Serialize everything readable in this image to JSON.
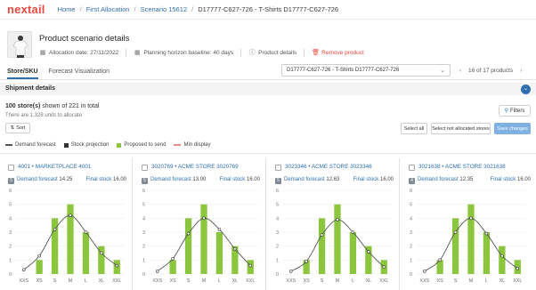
{
  "header": {
    "logo": "nextail",
    "breadcrumbs": [
      "Home",
      "First Allocation",
      "Scenario 15612"
    ],
    "current": "D17777-C627-726 - T-Shirts D17777-C627-726"
  },
  "product": {
    "title": "Product scenario details",
    "allocation_date": "Allocation date: 27/11/2022",
    "planning_horizon": "Planning horizon baseline: 40 days",
    "product_details": "Product details",
    "remove_product": "Remove product"
  },
  "tabs": [
    "Store/SKU",
    "Forecast Visualization"
  ],
  "selector": {
    "value": "D17777-C627-726 - T-Shirts D17777-C627-726"
  },
  "pager": {
    "text": "16 of 17 products"
  },
  "shipment": {
    "title": "Shipment details",
    "count_bold": "100 store(s)",
    "count_rest": " shown of 221 in total",
    "units": "There are 1,328 units to allocate",
    "filters": "Filters"
  },
  "actions": {
    "sort": "Sort",
    "select_all": "Select all",
    "select_not_allocated": "Select not allocated stores",
    "save_changes": "Save changes"
  },
  "legend": {
    "demand_forecast": "Demand forecast",
    "stock_projection": "Stock projection",
    "proposed_to_send": "Proposed to send",
    "min_display": "Min display"
  },
  "colors": {
    "accent": "#2f6fb0",
    "brand": "#e94a3f",
    "bar": "#8cc63f",
    "demand_line": "#555555",
    "stock": "#333333",
    "min_display": "#f08a8a"
  },
  "chart_data": [
    {
      "type": "bar",
      "title": "4001 • MARKETPLACE 4001",
      "badge": "5",
      "demand_forecast_label": "Demand forecast",
      "demand_forecast_total": "14.25",
      "final_stock_label": "Final stock",
      "final_stock_total": "16.00",
      "categories": [
        "XXS",
        "XS",
        "S",
        "M",
        "L",
        "XL",
        "XXL"
      ],
      "ylim": [
        0,
        6
      ],
      "yticks": [
        0,
        1,
        2,
        3,
        4,
        5,
        6
      ],
      "series": [
        {
          "name": "Proposed to send",
          "type": "bar",
          "values": [
            0,
            1,
            4,
            5,
            3,
            2,
            1
          ]
        },
        {
          "name": "Demand forecast",
          "type": "line",
          "values": [
            0.3,
            1.3,
            3.2,
            4.2,
            3.0,
            1.5,
            0.6
          ]
        }
      ]
    },
    {
      "type": "bar",
      "title": "3020769 • ACME STORE 3020769",
      "badge": "5",
      "demand_forecast_label": "Demand forecast",
      "demand_forecast_total": "13.00",
      "final_stock_label": "Final stock",
      "final_stock_total": "16.00",
      "categories": [
        "XXS",
        "XS",
        "S",
        "M",
        "L",
        "XL",
        "XXL"
      ],
      "ylim": [
        0,
        6
      ],
      "yticks": [
        0,
        1,
        2,
        3,
        4,
        5,
        6
      ],
      "series": [
        {
          "name": "Proposed to send",
          "type": "bar",
          "values": [
            0,
            1,
            4,
            5,
            3,
            2,
            1
          ]
        },
        {
          "name": "Demand forecast",
          "type": "line",
          "values": [
            0.2,
            1.1,
            2.9,
            4.0,
            3.2,
            1.8,
            0.6
          ]
        }
      ]
    },
    {
      "type": "bar",
      "title": "3023346 • ACME STORE 3023346",
      "badge": "5",
      "demand_forecast_label": "Demand forecast",
      "demand_forecast_total": "12.63",
      "final_stock_label": "Final stock",
      "final_stock_total": "16.00",
      "categories": [
        "XXS",
        "XS",
        "S",
        "M",
        "L",
        "XL",
        "XXL"
      ],
      "ylim": [
        0,
        6
      ],
      "yticks": [
        0,
        1,
        2,
        3,
        4,
        5,
        6
      ],
      "series": [
        {
          "name": "Proposed to send",
          "type": "bar",
          "values": [
            0,
            1,
            4,
            5,
            3,
            2,
            1
          ]
        },
        {
          "name": "Demand forecast",
          "type": "line",
          "values": [
            0.2,
            0.9,
            2.8,
            3.9,
            3.0,
            1.6,
            0.5
          ]
        }
      ]
    },
    {
      "type": "bar",
      "title": "3021638 • ACME STORE 3021638",
      "badge": "4",
      "demand_forecast_label": "Demand forecast",
      "demand_forecast_total": "12.35",
      "final_stock_label": "Final stock",
      "final_stock_total": "16.00",
      "categories": [
        "XXS",
        "XS",
        "S",
        "M",
        "L",
        "XL",
        "XXL"
      ],
      "ylim": [
        0,
        6
      ],
      "yticks": [
        0,
        1,
        2,
        3,
        4,
        5,
        6
      ],
      "series": [
        {
          "name": "Proposed to send",
          "type": "bar",
          "values": [
            0,
            1,
            4,
            5,
            3,
            2,
            1
          ]
        },
        {
          "name": "Demand forecast",
          "type": "line",
          "values": [
            0.2,
            1.0,
            3.0,
            4.0,
            2.9,
            1.3,
            0.4
          ]
        }
      ]
    }
  ]
}
